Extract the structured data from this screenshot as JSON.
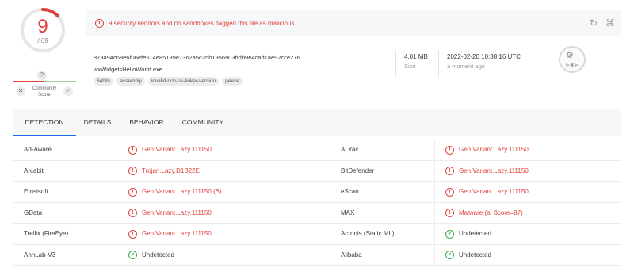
{
  "score": {
    "detections": "9",
    "total": "/ 69",
    "fraction": 0.13
  },
  "community": {
    "badge": "?",
    "label_line1": "Community",
    "label_line2": "Score",
    "negative_icon": "x-icon",
    "positive_icon": "check-icon"
  },
  "alert": {
    "icon": "!",
    "text": "9 security vendors and no sandboxes flagged this file as malicious",
    "tools": [
      "refresh-icon",
      "graph-icon"
    ]
  },
  "file": {
    "hash": "873a94c68e6f06efe614e85139e7362a5c35b1956903bdb9e4cad1ae92cce276",
    "name": "wxWidgetsHelloWorld.exe",
    "tags": [
      "64bits",
      "assembly",
      "invalid-rich-pe-linker-version",
      "peexe"
    ],
    "size_value": "4.01 MB",
    "size_label": "Size",
    "date_value": "2022-02-20 10:38:16 UTC",
    "date_label": "a moment ago",
    "type_label": "EXE"
  },
  "tabs": [
    "DETECTION",
    "DETAILS",
    "BEHAVIOR",
    "COMMUNITY"
  ],
  "colors": {
    "malicious": "#e0413c",
    "clean": "#3da84a",
    "accent": "#1a6ce6"
  },
  "detections": [
    {
      "left_engine": "Ad-Aware",
      "left_result": "Gen:Variant.Lazy.111150",
      "left_status": "malicious",
      "right_engine": "ALYac",
      "right_result": "Gen:Variant.Lazy.111150",
      "right_status": "malicious"
    },
    {
      "left_engine": "Arcabit",
      "left_result": "Trojan.Lazy.D1B22E",
      "left_status": "malicious",
      "right_engine": "BitDefender",
      "right_result": "Gen:Variant.Lazy.111150",
      "right_status": "malicious"
    },
    {
      "left_engine": "Emsisoft",
      "left_result": "Gen:Variant.Lazy.111150 (B)",
      "left_status": "malicious",
      "right_engine": "eScan",
      "right_result": "Gen:Variant.Lazy.111150",
      "right_status": "malicious"
    },
    {
      "left_engine": "GData",
      "left_result": "Gen:Variant.Lazy.111150",
      "left_status": "malicious",
      "right_engine": "MAX",
      "right_result": "Malware (ai Score=87)",
      "right_status": "malicious"
    },
    {
      "left_engine": "Trellix (FireEye)",
      "left_result": "Gen:Variant.Lazy.111150",
      "left_status": "malicious",
      "right_engine": "Acronis (Static ML)",
      "right_result": "Undetected",
      "right_status": "clean"
    },
    {
      "left_engine": "AhnLab-V3",
      "left_result": "Undetected",
      "left_status": "clean",
      "right_engine": "Alibaba",
      "right_result": "Undetected",
      "right_status": "clean"
    }
  ]
}
